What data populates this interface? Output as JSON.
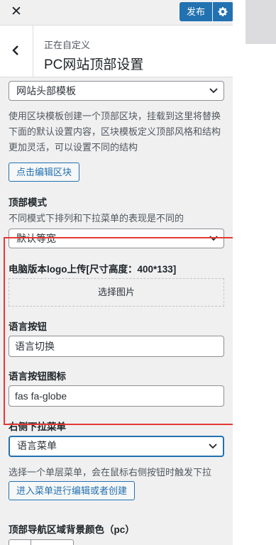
{
  "header": {
    "close_icon": "close-icon",
    "publish_label": "发布",
    "settings_icon": "gear-icon"
  },
  "section": {
    "breadcrumb": "正在自定义",
    "title": "PC网站顶部设置",
    "back_icon": "chevron-left-icon"
  },
  "fields": {
    "template_select": "网站头部模板",
    "template_desc": "使用区块模板创建一个顶部区块，挂载到这里将替换下面的默认设置内容，区块模板定义顶部风格和结构更加灵活，可以设置不同的结构",
    "edit_block_button": "点击编辑区块",
    "top_mode_label": "顶部模式",
    "top_mode_desc": "不同模式下排列和下拉菜单的表现是不同的",
    "top_mode_select": "默认等宽",
    "logo_label": "电脑版本logo上传[尺寸高度：400*133]",
    "choose_image_button": "选择图片",
    "lang_button_label": "语言按钮",
    "lang_button_value": "语言切换",
    "lang_icon_label": "语言按钮图标",
    "lang_icon_value": "fas fa-globe",
    "right_menu_label": "右侧下拉菜单",
    "right_menu_select": "语言菜单",
    "right_menu_desc": "选择一个单层菜单，会在鼠标右侧按钮时触发下拉",
    "edit_menu_button": "进入菜单进行编辑或者创建",
    "nav_bg_label": "顶部导航区域背景颜色（pc）"
  },
  "colors": {
    "accent": "#2271b1",
    "highlight_border": "#e53935",
    "panel_bg": "#f0f0f1"
  }
}
